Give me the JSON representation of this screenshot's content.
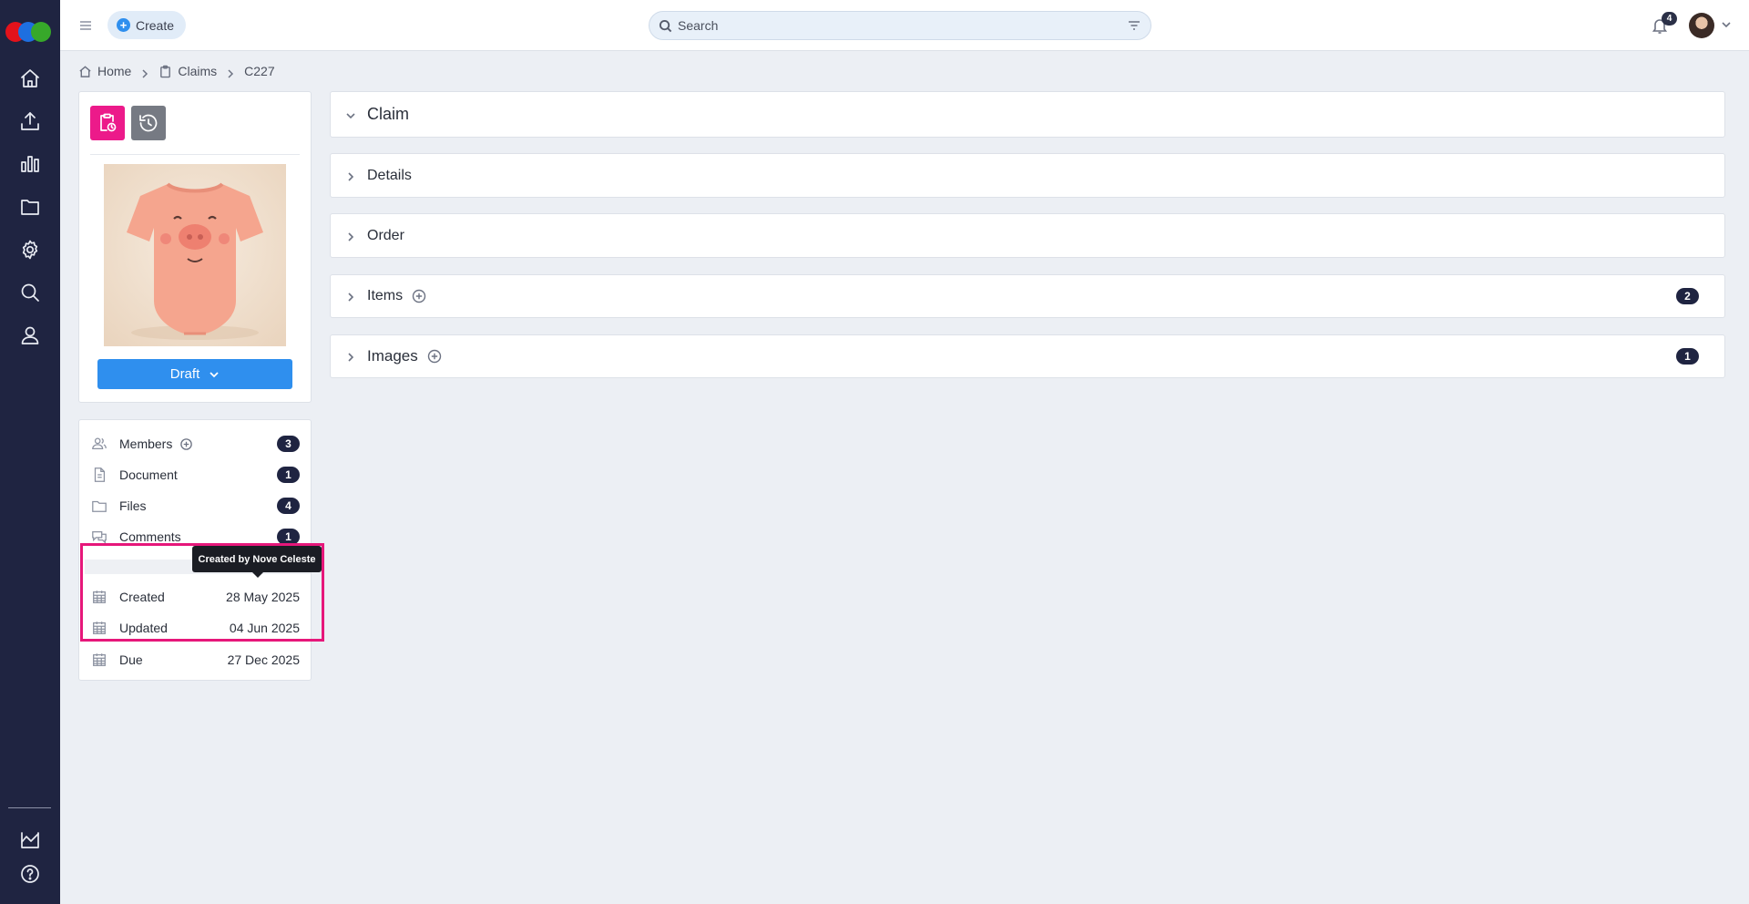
{
  "topbar": {
    "create_label": "Create",
    "search_placeholder": "Search",
    "notification_count": "4"
  },
  "breadcrumb": [
    "Home",
    "Claims",
    "C227"
  ],
  "status_button": "Draft",
  "meta": {
    "members": {
      "label": "Members",
      "count": "3"
    },
    "document": {
      "label": "Document",
      "count": "1"
    },
    "files": {
      "label": "Files",
      "count": "4"
    },
    "comments": {
      "label": "Comments",
      "count": "1"
    },
    "created": {
      "label": "Created",
      "value": "28 May 2025"
    },
    "updated": {
      "label": "Updated",
      "value": "04 Jun 2025"
    },
    "due": {
      "label": "Due",
      "value": "27 Dec 2025"
    }
  },
  "tooltip": "Created by Nove Celeste",
  "sections": {
    "claim": {
      "title": "Claim"
    },
    "details": {
      "title": "Details"
    },
    "order": {
      "title": "Order"
    },
    "items": {
      "title": "Items",
      "count": "2"
    },
    "images": {
      "title": "Images",
      "count": "1"
    }
  },
  "colors": {
    "rail": "#1f2441",
    "accent_blue": "#2f8fee",
    "accent_pink": "#e6177a",
    "badge": "#1f2441"
  },
  "icons": [
    "home-icon",
    "upload-icon",
    "bar-chart-icon",
    "folder-icon",
    "gear-icon",
    "search-icon",
    "user-icon",
    "analytics-icon",
    "help-icon"
  ]
}
